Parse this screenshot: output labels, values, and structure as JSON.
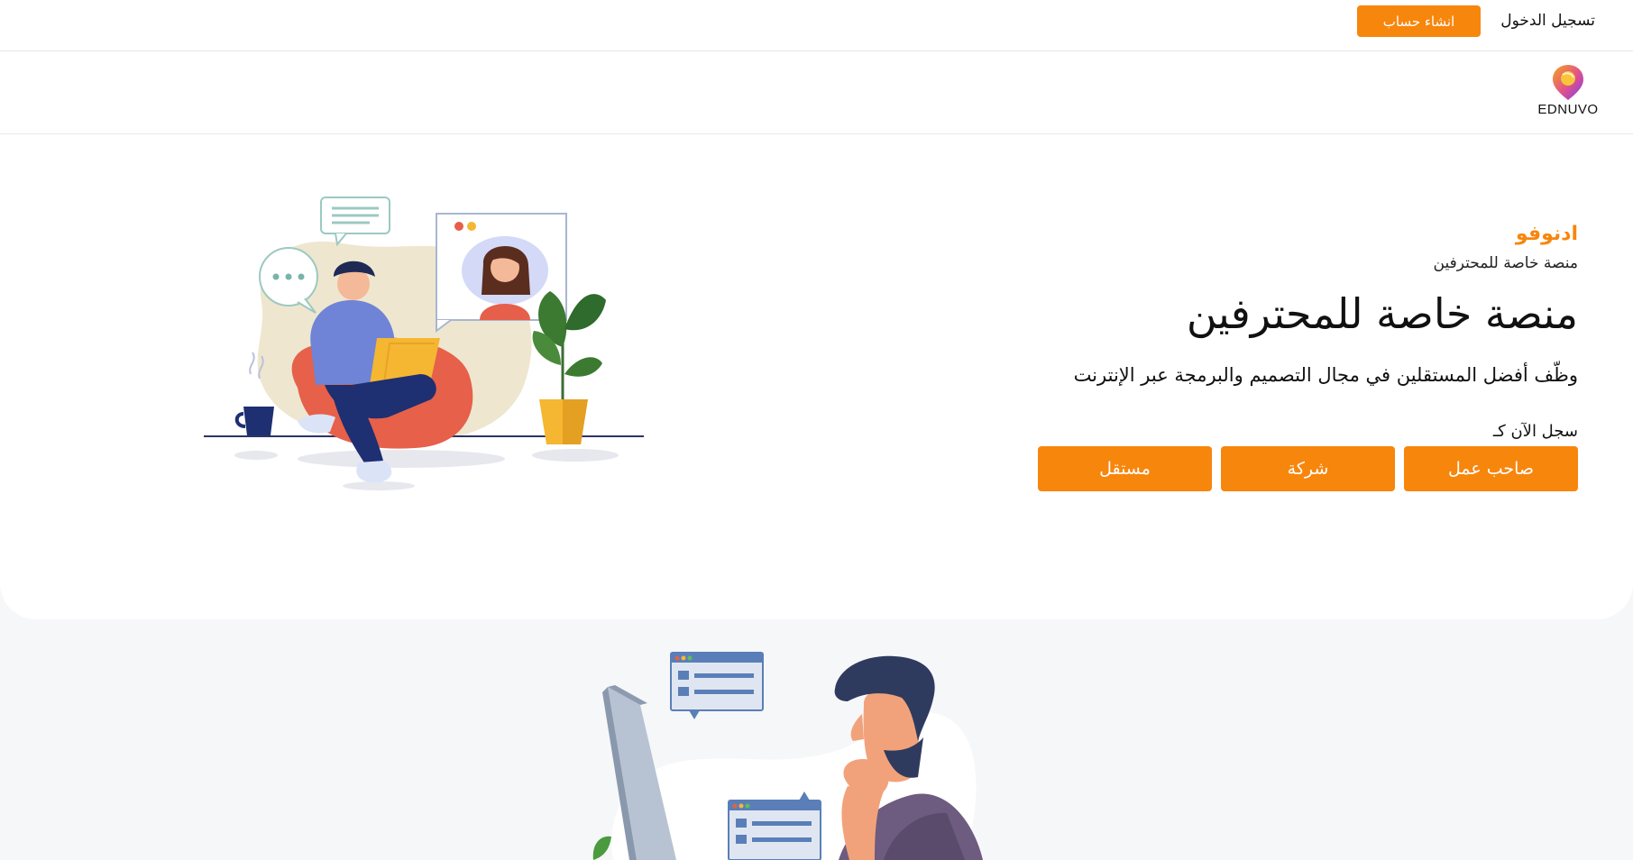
{
  "header": {
    "login_label": "تسجيل الدخول",
    "signup_label": "انشاء حساب"
  },
  "brand": {
    "name": "EDNUVO",
    "logo_icon": "map-pin-logo-icon",
    "logo_colors": [
      "#f7a21b",
      "#c44ad8",
      "#7b3fe4"
    ]
  },
  "hero": {
    "eyebrow": "ادنوفو",
    "eyebrow_sub": "منصة خاصة للمحترفين",
    "headline": "منصة خاصة للمحترفين",
    "subline": "وظّف أفضل المستقلين في مجال التصميم والبرمجة عبر الإنترنت",
    "cta_label": "سجل الآن كـ",
    "buttons": [
      "صاحب عمل",
      "شركة",
      "مستقل"
    ],
    "illustration": "freelancer-video-call-illustration"
  },
  "section2": {
    "illustration": "thinking-man-at-computer-illustration"
  },
  "colors": {
    "accent": "#f7860d",
    "section_background": "#f6f7f9"
  }
}
